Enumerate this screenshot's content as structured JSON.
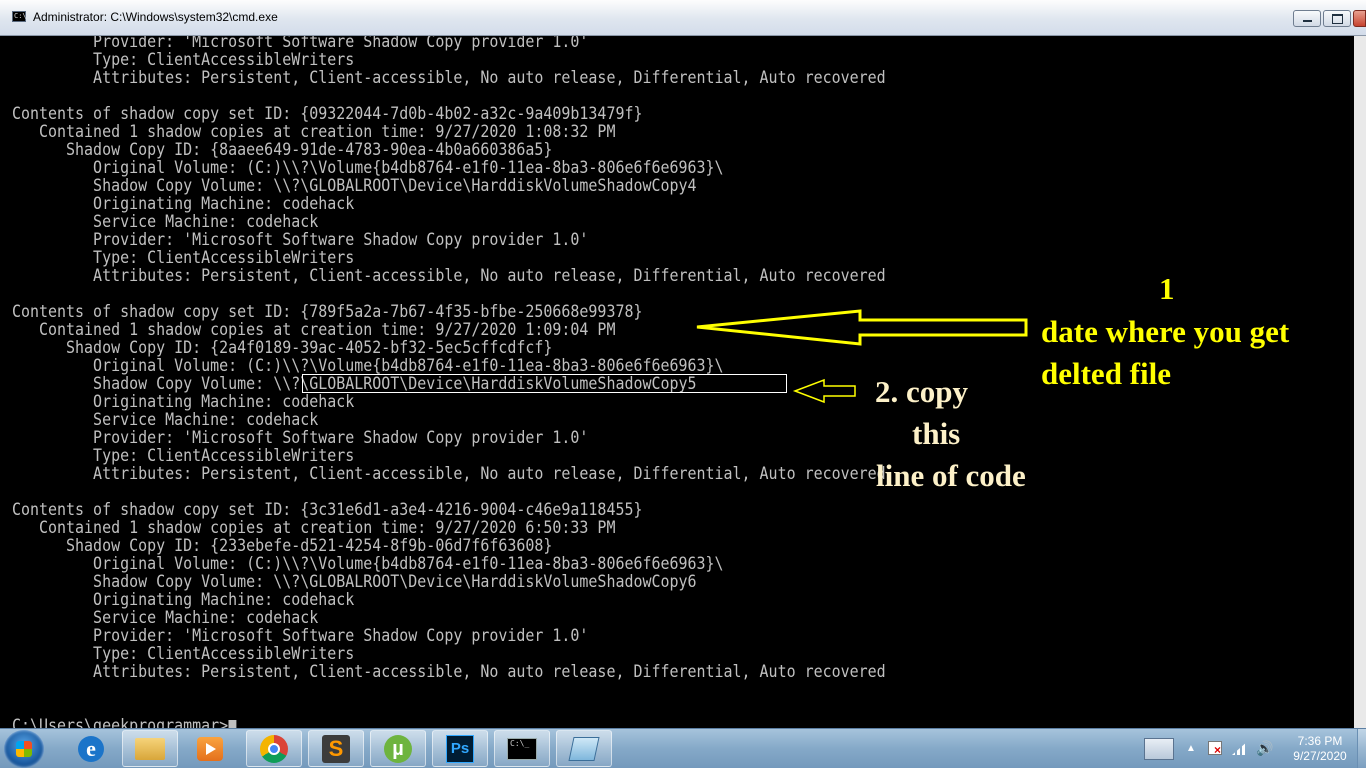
{
  "window": {
    "title": "Administrator: C:\\Windows\\system32\\cmd.exe"
  },
  "console": {
    "lines": [
      "         Provider: 'Microsoft Software Shadow Copy provider 1.0'",
      "         Type: ClientAccessibleWriters",
      "         Attributes: Persistent, Client-accessible, No auto release, Differential, Auto recovered",
      "",
      "Contents of shadow copy set ID: {09322044-7d0b-4b02-a32c-9a409b13479f}",
      "   Contained 1 shadow copies at creation time: 9/27/2020 1:08:32 PM",
      "      Shadow Copy ID: {8aaee649-91de-4783-90ea-4b0a660386a5}",
      "         Original Volume: (C:)\\\\?\\Volume{b4db8764-e1f0-11ea-8ba3-806e6f6e6963}\\",
      "         Shadow Copy Volume: \\\\?\\GLOBALROOT\\Device\\HarddiskVolumeShadowCopy4",
      "         Originating Machine: codehack",
      "         Service Machine: codehack",
      "         Provider: 'Microsoft Software Shadow Copy provider 1.0'",
      "         Type: ClientAccessibleWriters",
      "         Attributes: Persistent, Client-accessible, No auto release, Differential, Auto recovered",
      "",
      "Contents of shadow copy set ID: {789f5a2a-7b67-4f35-bfbe-250668e99378}",
      "   Contained 1 shadow copies at creation time: 9/27/2020 1:09:04 PM",
      "      Shadow Copy ID: {2a4f0189-39ac-4052-bf32-5ec5cffcdfcf}",
      "         Original Volume: (C:)\\\\?\\Volume{b4db8764-e1f0-11ea-8ba3-806e6f6e6963}\\",
      "         Shadow Copy Volume: \\\\?\\GLOBALROOT\\Device\\HarddiskVolumeShadowCopy5",
      "         Originating Machine: codehack",
      "         Service Machine: codehack",
      "         Provider: 'Microsoft Software Shadow Copy provider 1.0'",
      "         Type: ClientAccessibleWriters",
      "         Attributes: Persistent, Client-accessible, No auto release, Differential, Auto recovered",
      "",
      "Contents of shadow copy set ID: {3c31e6d1-a3e4-4216-9004-c46e9a118455}",
      "   Contained 1 shadow copies at creation time: 9/27/2020 6:50:33 PM",
      "      Shadow Copy ID: {233ebefe-d521-4254-8f9b-06d7f6f63608}",
      "         Original Volume: (C:)\\\\?\\Volume{b4db8764-e1f0-11ea-8ba3-806e6f6e6963}\\",
      "         Shadow Copy Volume: \\\\?\\GLOBALROOT\\Device\\HarddiskVolumeShadowCopy6",
      "         Originating Machine: codehack",
      "         Service Machine: codehack",
      "         Provider: 'Microsoft Software Shadow Copy provider 1.0'",
      "         Type: ClientAccessibleWriters",
      "         Attributes: Persistent, Client-accessible, No auto release, Differential, Auto recovered",
      "",
      "",
      "C:\\Users\\geekprogrammar>"
    ]
  },
  "annotations": {
    "step1_number": "1",
    "step1_line1": "date where you get",
    "step1_line2": "delted file",
    "step2_line1": "2. copy",
    "step2_line2": "this",
    "step2_line3": "line of code",
    "arrow_color": "#ffff00",
    "box_color": "#ffffff"
  },
  "taskbar": {
    "clock_time": "7:36 PM",
    "clock_date": "9/27/2020",
    "icons": [
      "windows-start-icon",
      "internet-explorer-icon",
      "folder-icon",
      "media-player-icon",
      "chrome-icon",
      "sublime-text-icon",
      "utorrent-icon",
      "photoshop-icon",
      "cmd-icon",
      "other-app-icon"
    ]
  },
  "colors": {
    "console_text": "#c0c0c0",
    "console_bg": "#000000",
    "annotation_step1": "#ffff00",
    "annotation_step2": "#fdf1c8"
  }
}
